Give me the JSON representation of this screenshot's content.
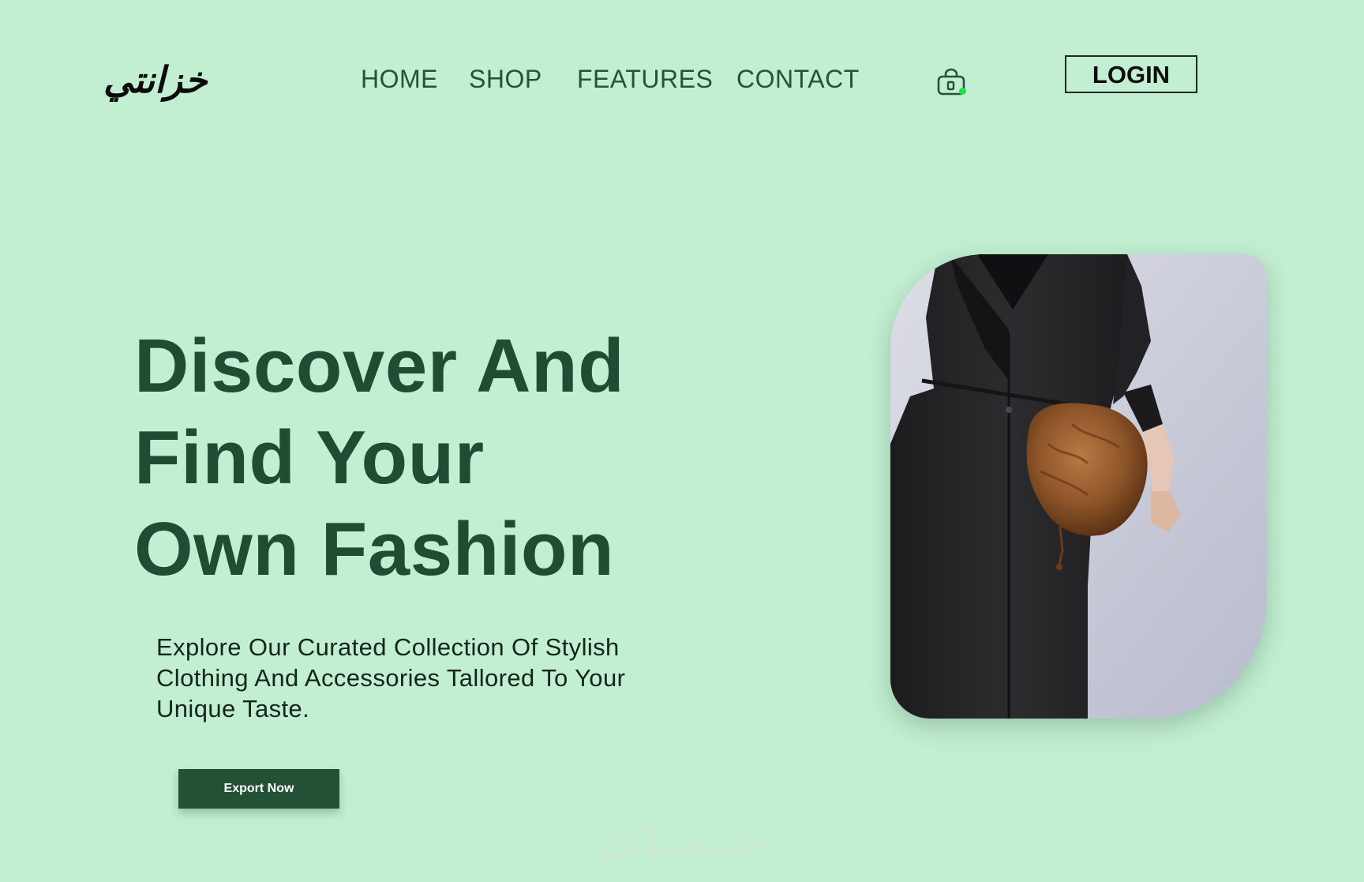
{
  "brand": {
    "logo_text": "خزانتي"
  },
  "nav": {
    "items": [
      {
        "label": "HOME"
      },
      {
        "label": "SHOP"
      },
      {
        "label": "FEATURES"
      },
      {
        "label": "CONTACT"
      }
    ],
    "cart_icon": "shopping-bag-icon",
    "login_label": "LOGIN"
  },
  "hero": {
    "title_lines": [
      "Discover And",
      "Find Your",
      "Own Fashion"
    ],
    "description": "Explore Our Curated Collection Of Stylish Clothing And Accessories Tallored To Your Unique Taste.",
    "cta_label": "Export Now",
    "image_description": "model-in-black-dress-with-brown-bag"
  },
  "watermark": {
    "text": "خمسات"
  },
  "colors": {
    "background": "#c2eed2",
    "primary_green": "#1e4d33",
    "button_green": "#235136",
    "cart_dot": "#23e04a"
  }
}
